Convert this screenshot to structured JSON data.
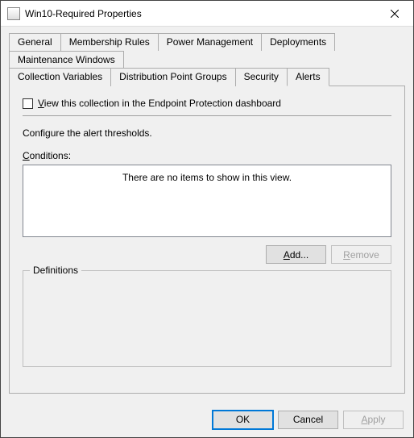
{
  "window": {
    "title": "Win10-Required Properties"
  },
  "tabs": {
    "general": "General",
    "membership": "Membership Rules",
    "power": "Power Management",
    "deployments": "Deployments",
    "maintenance": "Maintenance Windows",
    "collection_vars": "Collection Variables",
    "dist_groups": "Distribution Point Groups",
    "security": "Security",
    "alerts": "Alerts"
  },
  "alerts": {
    "view_checkbox_prefix": "V",
    "view_checkbox_rest": "iew this collection in the Endpoint Protection dashboard",
    "configure_text": "Configure the alert thresholds.",
    "conditions_prefix": "C",
    "conditions_rest": "onditions:",
    "empty_text": "There are no items to show in this view.",
    "add_prefix": "A",
    "add_rest": "dd...",
    "remove_prefix": "R",
    "remove_rest": "emove",
    "definitions_label": "Definitions"
  },
  "footer": {
    "ok": "OK",
    "cancel": "Cancel",
    "apply_prefix": "A",
    "apply_rest": "pply"
  }
}
